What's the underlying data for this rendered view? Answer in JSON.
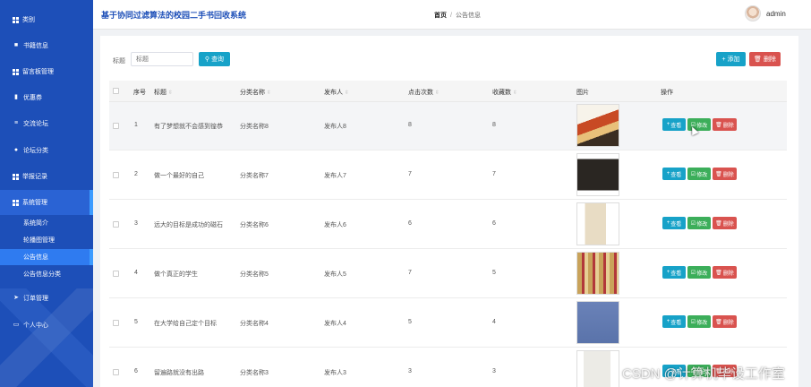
{
  "sidebar": {
    "items": [
      {
        "label": "类别",
        "icon": "grid-icon"
      },
      {
        "label": "书籍信息",
        "icon": "gift-icon"
      },
      {
        "label": "留言板管理",
        "icon": "grid-icon"
      },
      {
        "label": "优惠券",
        "icon": "bar-chart-icon"
      },
      {
        "label": "交流论坛",
        "icon": "list-icon"
      },
      {
        "label": "论坛分类",
        "icon": "user-icon"
      },
      {
        "label": "举报记录",
        "icon": "grid-icon"
      },
      {
        "label": "系统管理",
        "icon": "grid-icon"
      },
      {
        "label": "订单管理",
        "icon": "send-icon"
      },
      {
        "label": "个人中心",
        "icon": "window-icon"
      }
    ],
    "subitems": [
      {
        "label": "系统简介"
      },
      {
        "label": "轮播图管理"
      },
      {
        "label": "公告信息"
      },
      {
        "label": "公告信息分类"
      }
    ]
  },
  "header": {
    "app_title": "基于协同过滤算法的校园二手书回收系统",
    "breadcrumb_home": "首页",
    "breadcrumb_sep": "/",
    "breadcrumb_current": "公告信息",
    "user_name": "admin"
  },
  "search": {
    "label": "标题",
    "placeholder": "标题",
    "button": "查询"
  },
  "toolbar": {
    "add": "添加",
    "delete": "删除"
  },
  "table": {
    "headers": {
      "index": "序号",
      "title": "标题",
      "category": "分类名称",
      "publisher": "发布人",
      "clicks": "点击次数",
      "favorites": "收藏数",
      "image": "图片",
      "actions": "操作"
    },
    "row_buttons": {
      "view": "查看",
      "edit": "修改",
      "delete": "删除"
    },
    "rows": [
      {
        "index": "1",
        "title": "有了梦想就不会感到徨恭",
        "category": "分类名称8",
        "publisher": "发布人8",
        "clicks": "8",
        "favorites": "8",
        "cover": "book-cover-xiyouji"
      },
      {
        "index": "2",
        "title": "做一个最好的自己",
        "category": "分类名称7",
        "publisher": "发布人7",
        "clicks": "7",
        "favorites": "7",
        "cover": "book-cover-dark"
      },
      {
        "index": "3",
        "title": "远大的目标是成功的磁石",
        "category": "分类名称6",
        "publisher": "发布人6",
        "clicks": "6",
        "favorites": "6",
        "cover": "book-cover-plain"
      },
      {
        "index": "4",
        "title": "做个真正的学生",
        "category": "分类名称5",
        "publisher": "发布人5",
        "clicks": "7",
        "favorites": "5",
        "cover": "book-cover-set"
      },
      {
        "index": "5",
        "title": "在大学给自己定个目标",
        "category": "分类名称4",
        "publisher": "发布人4",
        "clicks": "5",
        "favorites": "4",
        "cover": "book-cover-blue"
      },
      {
        "index": "6",
        "title": "留遍路就没有出路",
        "category": "分类名称3",
        "publisher": "发布人3",
        "clicks": "3",
        "favorites": "3",
        "cover": "book-cover-calligraphy"
      }
    ]
  },
  "watermark": "CSDN @计算机毕设工作室",
  "colors": {
    "sidebar": "#1d4fb8",
    "primary": "#17a2c8",
    "success": "#3cae5a",
    "danger": "#d9534f"
  }
}
